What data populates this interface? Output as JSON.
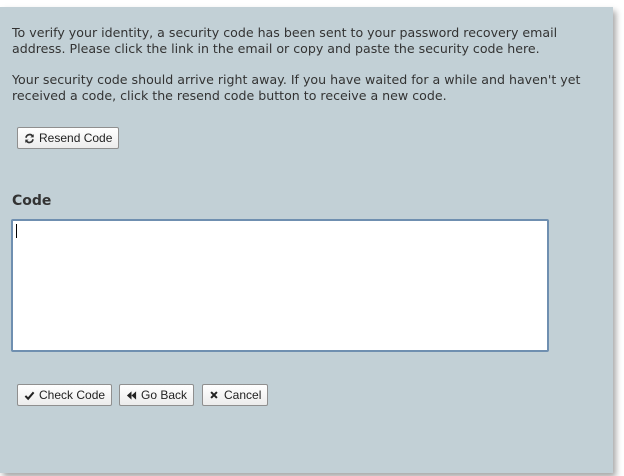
{
  "instructions": {
    "paragraph1": "To verify your identity, a security code has been sent to your password recovery email address. Please click the link in the email or copy and paste the security code here.",
    "paragraph2": "Your security code should arrive right away. If you have waited for a while and haven't yet received a code, click the resend code button to receive a new code."
  },
  "resend": {
    "label": "Resend Code",
    "icon": "refresh-icon"
  },
  "code": {
    "label": "Code",
    "value": "",
    "placeholder": ""
  },
  "actions": {
    "check_label": "Check Code",
    "check_icon": "checkmark-icon",
    "back_label": "Go Back",
    "back_icon": "rewind-icon",
    "cancel_label": "Cancel",
    "cancel_icon": "close-icon"
  },
  "colors": {
    "panel_background": "#c2d0d6",
    "field_focus_border": "#6f8fb0",
    "text": "#333333"
  }
}
